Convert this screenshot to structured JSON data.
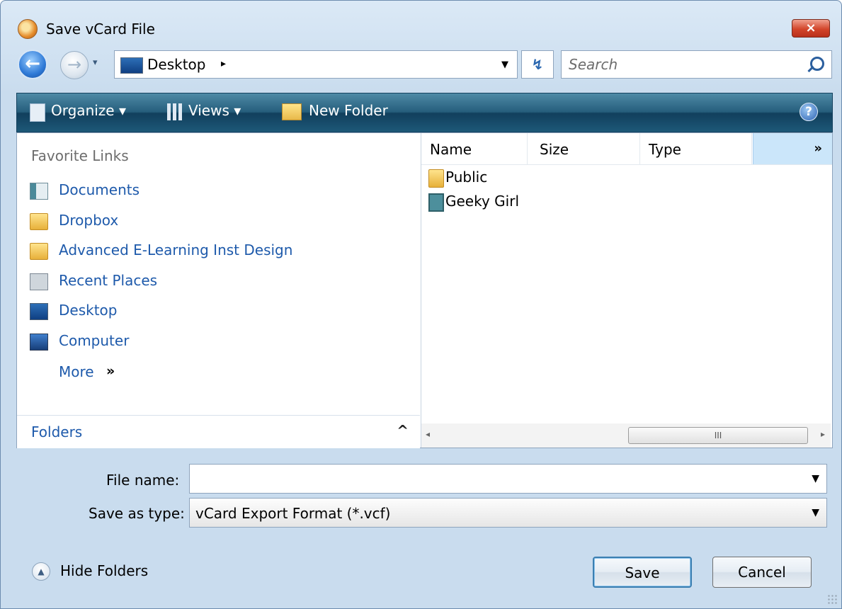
{
  "window": {
    "title": "Save vCard File",
    "close_glyph": "×"
  },
  "nav": {
    "back_glyph": "←",
    "forward_glyph": "→",
    "history_glyph": "▾",
    "address": "Desktop",
    "address_chevron": "▸",
    "address_dropdown": "▼",
    "refresh_glyph": "↯",
    "search_placeholder": "Search"
  },
  "toolbar": {
    "organize": "Organize ▾",
    "views": "Views ▾",
    "new_folder": "New Folder",
    "help_glyph": "?"
  },
  "favorites": {
    "heading": "Favorite Links",
    "items": [
      {
        "label": "Documents",
        "icon": "documents-icon"
      },
      {
        "label": "Dropbox",
        "icon": "folder-icon"
      },
      {
        "label": "Advanced E-Learning Inst Design",
        "icon": "folder-icon"
      },
      {
        "label": "Recent Places",
        "icon": "recent-places-icon"
      },
      {
        "label": "Desktop",
        "icon": "desktop-icon"
      },
      {
        "label": "Computer",
        "icon": "computer-icon"
      }
    ],
    "more": "More",
    "more_glyph": "»"
  },
  "folders_bar": {
    "label": "Folders",
    "chevron": "^"
  },
  "file_list": {
    "columns": [
      "Name",
      "Size",
      "Type"
    ],
    "more_columns_glyph": "»",
    "files": [
      {
        "name": "Public",
        "icon": "folder-icon"
      },
      {
        "name": "Geeky Girl",
        "icon": "contact-icon"
      }
    ],
    "scroll_left": "◂",
    "scroll_right": "▸",
    "scroll_thumb": "III"
  },
  "form": {
    "file_name_label": "File name:",
    "file_name_value": "",
    "save_as_type_label": "Save as type:",
    "save_as_type_value": "vCard Export Format (*.vcf)",
    "dropdown_glyph": "▼"
  },
  "footer": {
    "hide_folders_glyph": "▲",
    "hide_folders": "Hide Folders",
    "save": "Save",
    "cancel": "Cancel"
  }
}
